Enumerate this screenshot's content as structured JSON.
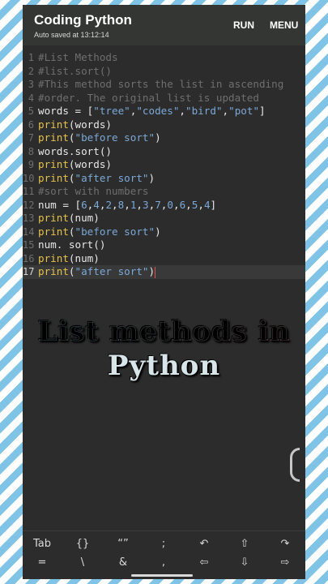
{
  "app": {
    "title": "Coding Python",
    "autosave": "Auto saved at 13:12:14",
    "run_label": "RUN",
    "menu_label": "MENU"
  },
  "editor": {
    "lines": [
      {
        "num": "1",
        "code": "#List Methods"
      },
      {
        "num": "2",
        "code": "#list.sort()"
      },
      {
        "num": "3",
        "code": "#This method sorts the list in ascending"
      },
      {
        "num": "4",
        "code": "#order. The original list is updated"
      },
      {
        "num": "5",
        "code": "words = [\"tree\",\"codes\",\"bird\",\"pot\"]"
      },
      {
        "num": "6",
        "code": "print(words)"
      },
      {
        "num": "7",
        "code": "print(\"before sort\")"
      },
      {
        "num": "8",
        "code": "words.sort()"
      },
      {
        "num": "9",
        "code": "print(words)"
      },
      {
        "num": "10",
        "code": "print(\"after sort\")"
      },
      {
        "num": "11",
        "code": "#sort with numbers"
      },
      {
        "num": "12",
        "code": "num = [6,4,2,8,1,3,7,0,6,5,4]"
      },
      {
        "num": "13",
        "code": "print(num)"
      },
      {
        "num": "14",
        "code": "print(\"before sort\")"
      },
      {
        "num": "15",
        "code": "num. sort()"
      },
      {
        "num": "16",
        "code": "print(num)"
      },
      {
        "num": "17",
        "code": "print(\"after sort\")"
      }
    ]
  },
  "overlay": {
    "line1": "List methods in",
    "line2": "Python"
  },
  "keyboard": {
    "row1": [
      "Tab",
      "{}",
      "“”",
      ";",
      "↶",
      "⇧",
      "↷"
    ],
    "row2": [
      "=",
      "\\",
      "&",
      ",",
      "⇦",
      "⇩",
      "⇨"
    ]
  },
  "colors": {
    "background": "#2b2c2b",
    "appbar": "#343634",
    "keyword": "#e6c24c",
    "string": "#7ca9d8",
    "comment": "#6f6f6f",
    "stripe": "#7fc4e6"
  }
}
